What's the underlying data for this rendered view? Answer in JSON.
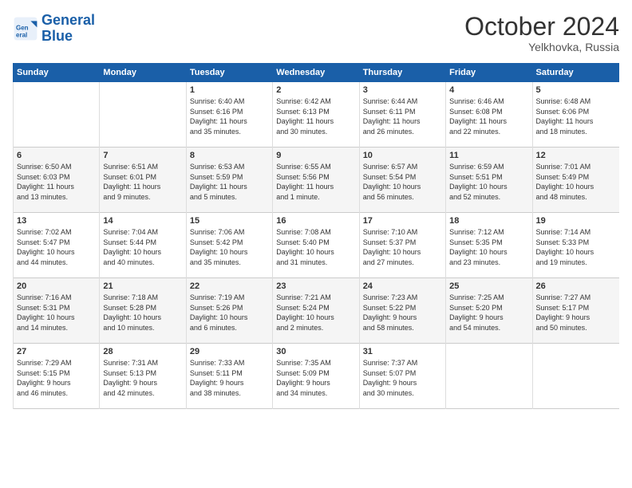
{
  "header": {
    "logo_line1": "General",
    "logo_line2": "Blue",
    "month": "October 2024",
    "location": "Yelkhovka, Russia"
  },
  "days_of_week": [
    "Sunday",
    "Monday",
    "Tuesday",
    "Wednesday",
    "Thursday",
    "Friday",
    "Saturday"
  ],
  "weeks": [
    [
      {
        "day": "",
        "info": ""
      },
      {
        "day": "",
        "info": ""
      },
      {
        "day": "1",
        "info": "Sunrise: 6:40 AM\nSunset: 6:16 PM\nDaylight: 11 hours\nand 35 minutes."
      },
      {
        "day": "2",
        "info": "Sunrise: 6:42 AM\nSunset: 6:13 PM\nDaylight: 11 hours\nand 30 minutes."
      },
      {
        "day": "3",
        "info": "Sunrise: 6:44 AM\nSunset: 6:11 PM\nDaylight: 11 hours\nand 26 minutes."
      },
      {
        "day": "4",
        "info": "Sunrise: 6:46 AM\nSunset: 6:08 PM\nDaylight: 11 hours\nand 22 minutes."
      },
      {
        "day": "5",
        "info": "Sunrise: 6:48 AM\nSunset: 6:06 PM\nDaylight: 11 hours\nand 18 minutes."
      }
    ],
    [
      {
        "day": "6",
        "info": "Sunrise: 6:50 AM\nSunset: 6:03 PM\nDaylight: 11 hours\nand 13 minutes."
      },
      {
        "day": "7",
        "info": "Sunrise: 6:51 AM\nSunset: 6:01 PM\nDaylight: 11 hours\nand 9 minutes."
      },
      {
        "day": "8",
        "info": "Sunrise: 6:53 AM\nSunset: 5:59 PM\nDaylight: 11 hours\nand 5 minutes."
      },
      {
        "day": "9",
        "info": "Sunrise: 6:55 AM\nSunset: 5:56 PM\nDaylight: 11 hours\nand 1 minute."
      },
      {
        "day": "10",
        "info": "Sunrise: 6:57 AM\nSunset: 5:54 PM\nDaylight: 10 hours\nand 56 minutes."
      },
      {
        "day": "11",
        "info": "Sunrise: 6:59 AM\nSunset: 5:51 PM\nDaylight: 10 hours\nand 52 minutes."
      },
      {
        "day": "12",
        "info": "Sunrise: 7:01 AM\nSunset: 5:49 PM\nDaylight: 10 hours\nand 48 minutes."
      }
    ],
    [
      {
        "day": "13",
        "info": "Sunrise: 7:02 AM\nSunset: 5:47 PM\nDaylight: 10 hours\nand 44 minutes."
      },
      {
        "day": "14",
        "info": "Sunrise: 7:04 AM\nSunset: 5:44 PM\nDaylight: 10 hours\nand 40 minutes."
      },
      {
        "day": "15",
        "info": "Sunrise: 7:06 AM\nSunset: 5:42 PM\nDaylight: 10 hours\nand 35 minutes."
      },
      {
        "day": "16",
        "info": "Sunrise: 7:08 AM\nSunset: 5:40 PM\nDaylight: 10 hours\nand 31 minutes."
      },
      {
        "day": "17",
        "info": "Sunrise: 7:10 AM\nSunset: 5:37 PM\nDaylight: 10 hours\nand 27 minutes."
      },
      {
        "day": "18",
        "info": "Sunrise: 7:12 AM\nSunset: 5:35 PM\nDaylight: 10 hours\nand 23 minutes."
      },
      {
        "day": "19",
        "info": "Sunrise: 7:14 AM\nSunset: 5:33 PM\nDaylight: 10 hours\nand 19 minutes."
      }
    ],
    [
      {
        "day": "20",
        "info": "Sunrise: 7:16 AM\nSunset: 5:31 PM\nDaylight: 10 hours\nand 14 minutes."
      },
      {
        "day": "21",
        "info": "Sunrise: 7:18 AM\nSunset: 5:28 PM\nDaylight: 10 hours\nand 10 minutes."
      },
      {
        "day": "22",
        "info": "Sunrise: 7:19 AM\nSunset: 5:26 PM\nDaylight: 10 hours\nand 6 minutes."
      },
      {
        "day": "23",
        "info": "Sunrise: 7:21 AM\nSunset: 5:24 PM\nDaylight: 10 hours\nand 2 minutes."
      },
      {
        "day": "24",
        "info": "Sunrise: 7:23 AM\nSunset: 5:22 PM\nDaylight: 9 hours\nand 58 minutes."
      },
      {
        "day": "25",
        "info": "Sunrise: 7:25 AM\nSunset: 5:20 PM\nDaylight: 9 hours\nand 54 minutes."
      },
      {
        "day": "26",
        "info": "Sunrise: 7:27 AM\nSunset: 5:17 PM\nDaylight: 9 hours\nand 50 minutes."
      }
    ],
    [
      {
        "day": "27",
        "info": "Sunrise: 7:29 AM\nSunset: 5:15 PM\nDaylight: 9 hours\nand 46 minutes."
      },
      {
        "day": "28",
        "info": "Sunrise: 7:31 AM\nSunset: 5:13 PM\nDaylight: 9 hours\nand 42 minutes."
      },
      {
        "day": "29",
        "info": "Sunrise: 7:33 AM\nSunset: 5:11 PM\nDaylight: 9 hours\nand 38 minutes."
      },
      {
        "day": "30",
        "info": "Sunrise: 7:35 AM\nSunset: 5:09 PM\nDaylight: 9 hours\nand 34 minutes."
      },
      {
        "day": "31",
        "info": "Sunrise: 7:37 AM\nSunset: 5:07 PM\nDaylight: 9 hours\nand 30 minutes."
      },
      {
        "day": "",
        "info": ""
      },
      {
        "day": "",
        "info": ""
      }
    ]
  ]
}
